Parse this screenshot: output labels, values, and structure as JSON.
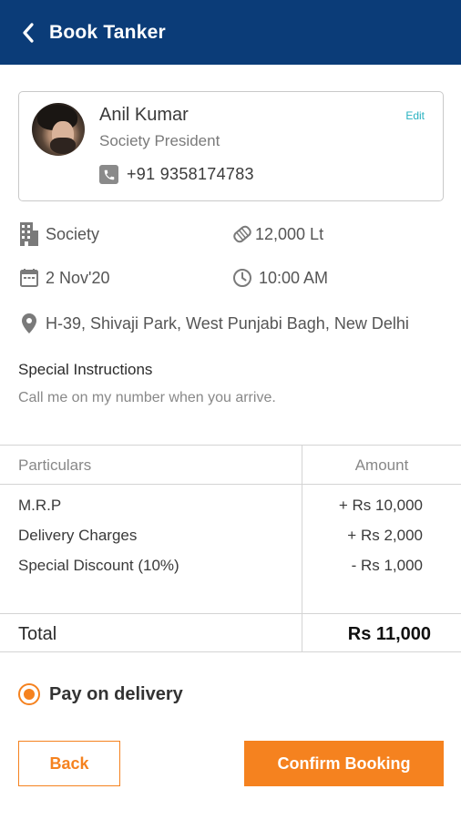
{
  "header": {
    "title": "Book Tanker",
    "back_icon": "chevron-left-icon",
    "background": "#0b3c78"
  },
  "profile": {
    "name": "Anil Kumar",
    "role": "Society President",
    "edit_label": "Edit",
    "phone": "+91 9358174783",
    "phone_icon": "phone-icon"
  },
  "details": {
    "type": "Society",
    "type_icon": "building-icon",
    "quantity": "12,000 Lt",
    "quantity_icon": "tanker-icon",
    "date": "2 Nov'20",
    "date_icon": "calendar-icon",
    "time": "10:00 AM",
    "time_icon": "clock-icon",
    "address": "H-39, Shivaji Park, West Punjabi Bagh, New Delhi",
    "address_icon": "location-pin-icon"
  },
  "instructions": {
    "title": "Special Instructions",
    "text": "Call me on my number when you arrive."
  },
  "pricing": {
    "headers": {
      "particulars": "Particulars",
      "amount": "Amount"
    },
    "rows": [
      {
        "label": "M.R.P",
        "value": "+ Rs 10,000"
      },
      {
        "label": "Delivery Charges",
        "value": "+ Rs 2,000"
      },
      {
        "label": "Special Discount (10%)",
        "value": "- Rs 1,000"
      }
    ],
    "total_label": "Total",
    "total_value": "Rs 11,000"
  },
  "payment": {
    "option_label": "Pay on delivery",
    "selected": true
  },
  "actions": {
    "back_label": "Back",
    "confirm_label": "Confirm Booking"
  },
  "colors": {
    "accent": "#f5821f",
    "primary": "#0b3c78",
    "link": "#27b1c0"
  }
}
